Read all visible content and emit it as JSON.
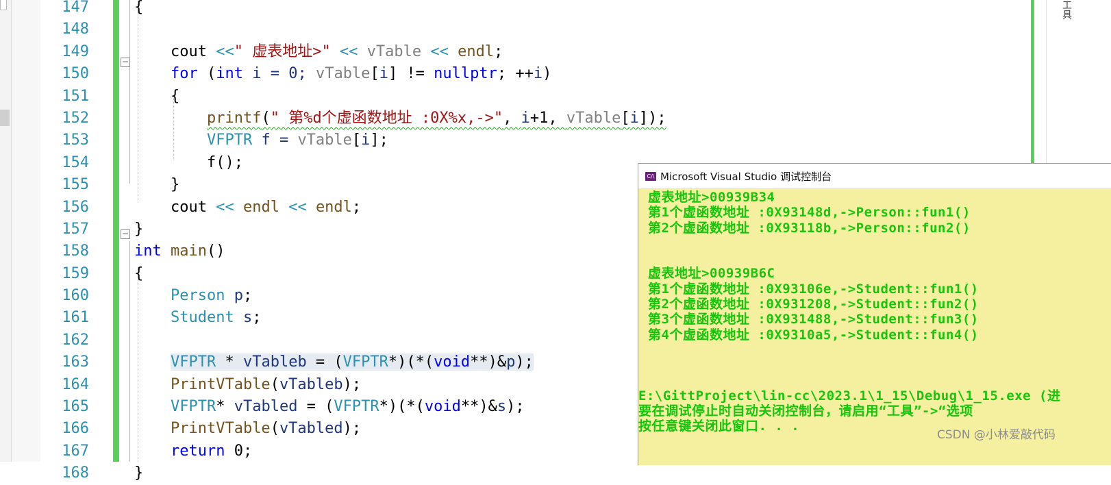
{
  "line_numbers": [
    "147",
    "148",
    "149",
    "150",
    "151",
    "152",
    "153",
    "154",
    "155",
    "156",
    "157",
    "158",
    "159",
    "160",
    "161",
    "162",
    "163",
    "164",
    "165",
    "166",
    "167",
    "168"
  ],
  "code": {
    "l147": "{",
    "l149": {
      "a": "cout ",
      "op1": "<<",
      "str": "\" 虚表地址>\"",
      "op2": " << ",
      "v": "vTable",
      "op3": " << ",
      "end": "endl",
      "semi": ";"
    },
    "l150": {
      "for": "for",
      "p1": " (",
      "int": "int",
      "i": " i = 0; ",
      "v": "vTable",
      "br": "[",
      "i2": "i",
      "br2": "] != ",
      "nul": "nullptr",
      "rest": "; ++",
      "i3": "i",
      "close": ")"
    },
    "l151": "{",
    "l152": {
      "fn": "printf",
      "op": "(",
      "str": "\" 第%d个虚函数地址 :0X%x,->\"",
      "c1": ", ",
      "i": "i",
      "p": "+1, ",
      "v": "vTable",
      "br": "[",
      "i2": "i",
      "end": "]);"
    },
    "l153": {
      "ty": "VFPTR",
      "f": " f = ",
      "v": "vTable",
      "br": "[",
      "i": "i",
      "end": "];"
    },
    "l154": "f();",
    "l155": "}",
    "l156": {
      "a": "cout ",
      "op1": "<<",
      "e1": " endl",
      "op2": " << ",
      "e2": "endl",
      "semi": ";"
    },
    "l157": "}",
    "l158": {
      "kw": "int",
      "fn": " main",
      "rest": "()"
    },
    "l159": "{",
    "l160": {
      "ty": "Person",
      "v": " p",
      "semi": ";"
    },
    "l161": {
      "ty": "Student",
      "v": " s",
      "semi": ";"
    },
    "l163": {
      "ty": "VFPTR",
      "a": " * ",
      "v": "vTableb",
      "b": " = (",
      "ty2": "VFPTR",
      "c": "*)(*(",
      "kw": "void",
      "d": "**)&",
      "p": "p",
      "e": ");"
    },
    "l164": {
      "fn": "PrintVTable",
      "a": "(",
      "v": "vTableb",
      "e": ");"
    },
    "l165": {
      "ty": "VFPTR",
      "a": "* ",
      "v": "vTabled",
      "b": " = (",
      "ty2": "VFPTR",
      "c": "*)(*(",
      "kw": "void",
      "d": "**)&",
      "p": "s",
      "e": ");"
    },
    "l166": {
      "fn": "PrintVTable",
      "a": "(",
      "v": "vTabled",
      "e": ");"
    },
    "l167": {
      "kw": "return",
      "rest": " 0;"
    },
    "l168": "}"
  },
  "side_tab": "工具",
  "console": {
    "title": "Microsoft Visual Studio 调试控制台",
    "icon": "C/\\",
    "lines": [
      "虚表地址>00939B34",
      "第1个虚函数地址 :0X93148d,->Person::fun1()",
      "第2个虚函数地址 :0X93118b,->Person::fun2()",
      "",
      "",
      "虚表地址>00939B6C",
      "第1个虚函数地址 :0X93106e,->Student::fun1()",
      "第2个虚函数地址 :0X931208,->Student::fun2()",
      "第3个虚函数地址 :0X931488,->Student::fun3()",
      "第4个虚函数地址 :0X9310a5,->Student::fun4()",
      "",
      "",
      "",
      ""
    ],
    "footer_lines": [
      "E:\\GittProject\\lin-cc\\2023.1\\1_15\\Debug\\1_15.exe (进",
      "要在调试停止时自动关闭控制台，请启用“工具”->“选项",
      "按任意键关闭此窗口. . ."
    ]
  },
  "watermark": "CSDN @小林爱敲代码"
}
